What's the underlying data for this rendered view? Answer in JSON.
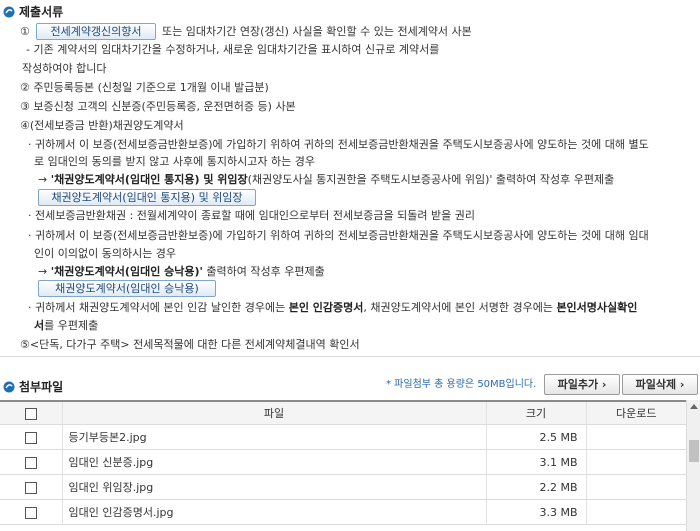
{
  "submit": {
    "title": "제출서류",
    "item1_num": "①",
    "item1_button": "전세계약갱신의향서",
    "item1_text": "또는 임대차기간 연장(갱신) 사실을 확인할 수 있는 전세계약서 사본",
    "item1_sub1": "- 기존 계약서의 임대차기간을 수정하거나, 새로운 임대차기간을 표시하여 신규로 계약서를",
    "item1_sub2": "작성하여야 합니다",
    "item2": "② 주민등록등본 (신청일 기준으로 1개월 이내 발급분)",
    "item3": "③ 보증신청 고객의 신분증(주민등록증, 운전면허증 등) 사본",
    "item4": "④(전세보증금 반환)채권양도계약서",
    "b1_l1": "· 귀하께서 이 보증(전세보증금반환보증)에 가입하기 위하여 귀하의 전세보증금반환채권을 주택도시보증공사에 양도하는 것에 대해 별도",
    "b1_l2": "로 임대인의 동의를 받지 않고 사후에 통지하시고자 하는 경우",
    "b1_arrow_a": "→ ",
    "b1_arrow_bold1": "'채권양도계약서(임대인 통지용) 및 위임장",
    "b1_arrow_mid": "(채권양도사실 통지권한을 주택도시보증공사에 위임)",
    "b1_arrow_end": "' 출력하여 작성후 우편제출",
    "b1_button": "채권양도계약서(임대인 통지용) 및 위임장",
    "b2": "· 전세보증금반환채권 : 전월세계약이 종료할 때에 임대인으로부터 전세보증금을 되돌려 받을 권리",
    "b3_l1": "· 귀하께서 이 보증(전세보증금반환보증)에 가입하기 위하여 귀하의 전세보증금반환채권을 주택도시보증공사에 양도하는 것에 대해 임대",
    "b3_l2": "인이 이의없이 동의하시는 경우",
    "b3_arrow_a": "→ ",
    "b3_arrow_bold": "'채권양도계약서(임대인 승낙용)'",
    "b3_arrow_end": " 출력하여 작성후 우편제출",
    "b3_button": "채권양도계약서(임대인 승낙용)",
    "b4_l1_a": "· 귀하께서 채권양도계약서에 본인 인감 날인한 경우에는 ",
    "b4_l1_b": "본인 인감증명서",
    "b4_l1_c": ", 채권양도계약서에 본인 서명한 경우에는 ",
    "b4_l1_d": "본인서명사실확인",
    "b4_l2_a": "서",
    "b4_l2_b": "를 우편제출",
    "item5": "⑤<단독, 다가구 주택> 전세목적물에 대한 다른 전세계약체결내역 확인서"
  },
  "attach": {
    "title": "첨부파일",
    "note": "* 파일첨부 총 용량은 50MB입니다.",
    "add_button": "파일추가 ›",
    "delete_button": "파일삭제 ›",
    "columns": {
      "file": "파일",
      "size": "크기",
      "download": "다운로드"
    },
    "rows": [
      {
        "name": "등기부등본2.jpg",
        "size": "2.5 MB",
        "download": ""
      },
      {
        "name": "임대인 신분증.jpg",
        "size": "3.1 MB",
        "download": ""
      },
      {
        "name": "임대인 위임장.jpg",
        "size": "2.2 MB",
        "download": ""
      },
      {
        "name": "임대인 인감증명서.jpg",
        "size": "3.3 MB",
        "download": ""
      }
    ]
  },
  "colors": {
    "accent": "#1f6fb5",
    "button_border": "#7ea7c9"
  },
  "icons": {
    "section": "blue-bullet-icon",
    "scroll_up": "triangle-up-icon"
  }
}
